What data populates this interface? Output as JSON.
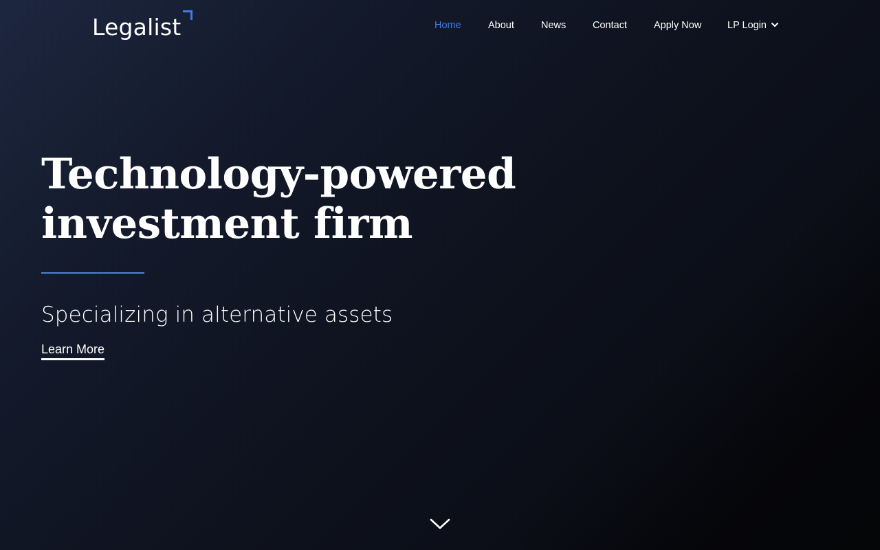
{
  "header": {
    "logo_text": "Legalist",
    "nav": [
      {
        "label": "Home",
        "active": true
      },
      {
        "label": "About"
      },
      {
        "label": "News"
      },
      {
        "label": "Contact"
      },
      {
        "label": "Apply Now"
      },
      {
        "label": "LP Login",
        "has_dropdown": true
      }
    ]
  },
  "hero": {
    "headline_line1": "Technology-powered",
    "headline_line2": "investment firm",
    "subheadline": "Specializing in alternative assets",
    "cta_label": "Learn More"
  },
  "icons": {
    "logo_mark": "corner-bracket-icon",
    "nav_dropdown": "chevron-down-icon",
    "scroll": "chevron-down-icon"
  },
  "colors": {
    "accent": "#3d7ee6",
    "divider": "#4d82cf",
    "background": "#0c0f18",
    "text": "#ffffff"
  }
}
